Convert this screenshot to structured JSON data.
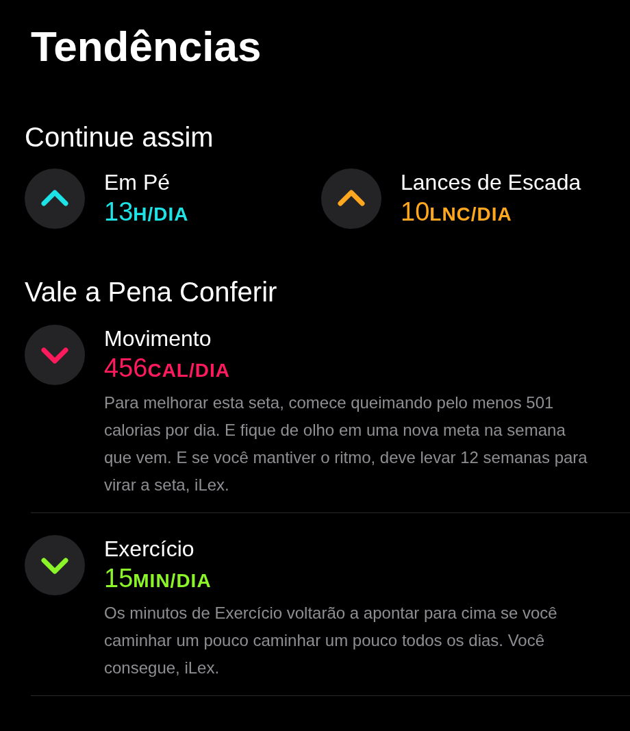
{
  "title": "Tendências",
  "sections": [
    {
      "heading": "Continue assim",
      "kind": "grid",
      "items": [
        {
          "kind": "up",
          "color": "#1ee3e6",
          "name": "Em Pé",
          "value": "13",
          "unit": "H/DIA"
        },
        {
          "kind": "up",
          "color": "#ffa81f",
          "name": "Lances de Escada",
          "value": "10",
          "unit": "LNC/DIA"
        }
      ]
    },
    {
      "heading": "Vale a Pena Conferir",
      "kind": "list",
      "items": [
        {
          "kind": "down",
          "color": "#ff1a5e",
          "name": "Movimento",
          "value": "456",
          "unit": "CAL/DIA",
          "description": "Para melhorar esta seta, comece queimando pelo menos 501 calorias por dia. E fique de olho em uma nova meta na semana que vem. E se você mantiver o ritmo, deve levar 12 semanas para virar a seta, iLex."
        },
        {
          "kind": "down",
          "color": "#8cf52a",
          "name": "Exercício",
          "value": "15",
          "unit": "MIN/DIA",
          "description": "Os minutos de Exercício voltarão a apontar para cima se você caminhar um pouco caminhar um pouco todos os dias. Você consegue, iLex."
        }
      ]
    }
  ]
}
